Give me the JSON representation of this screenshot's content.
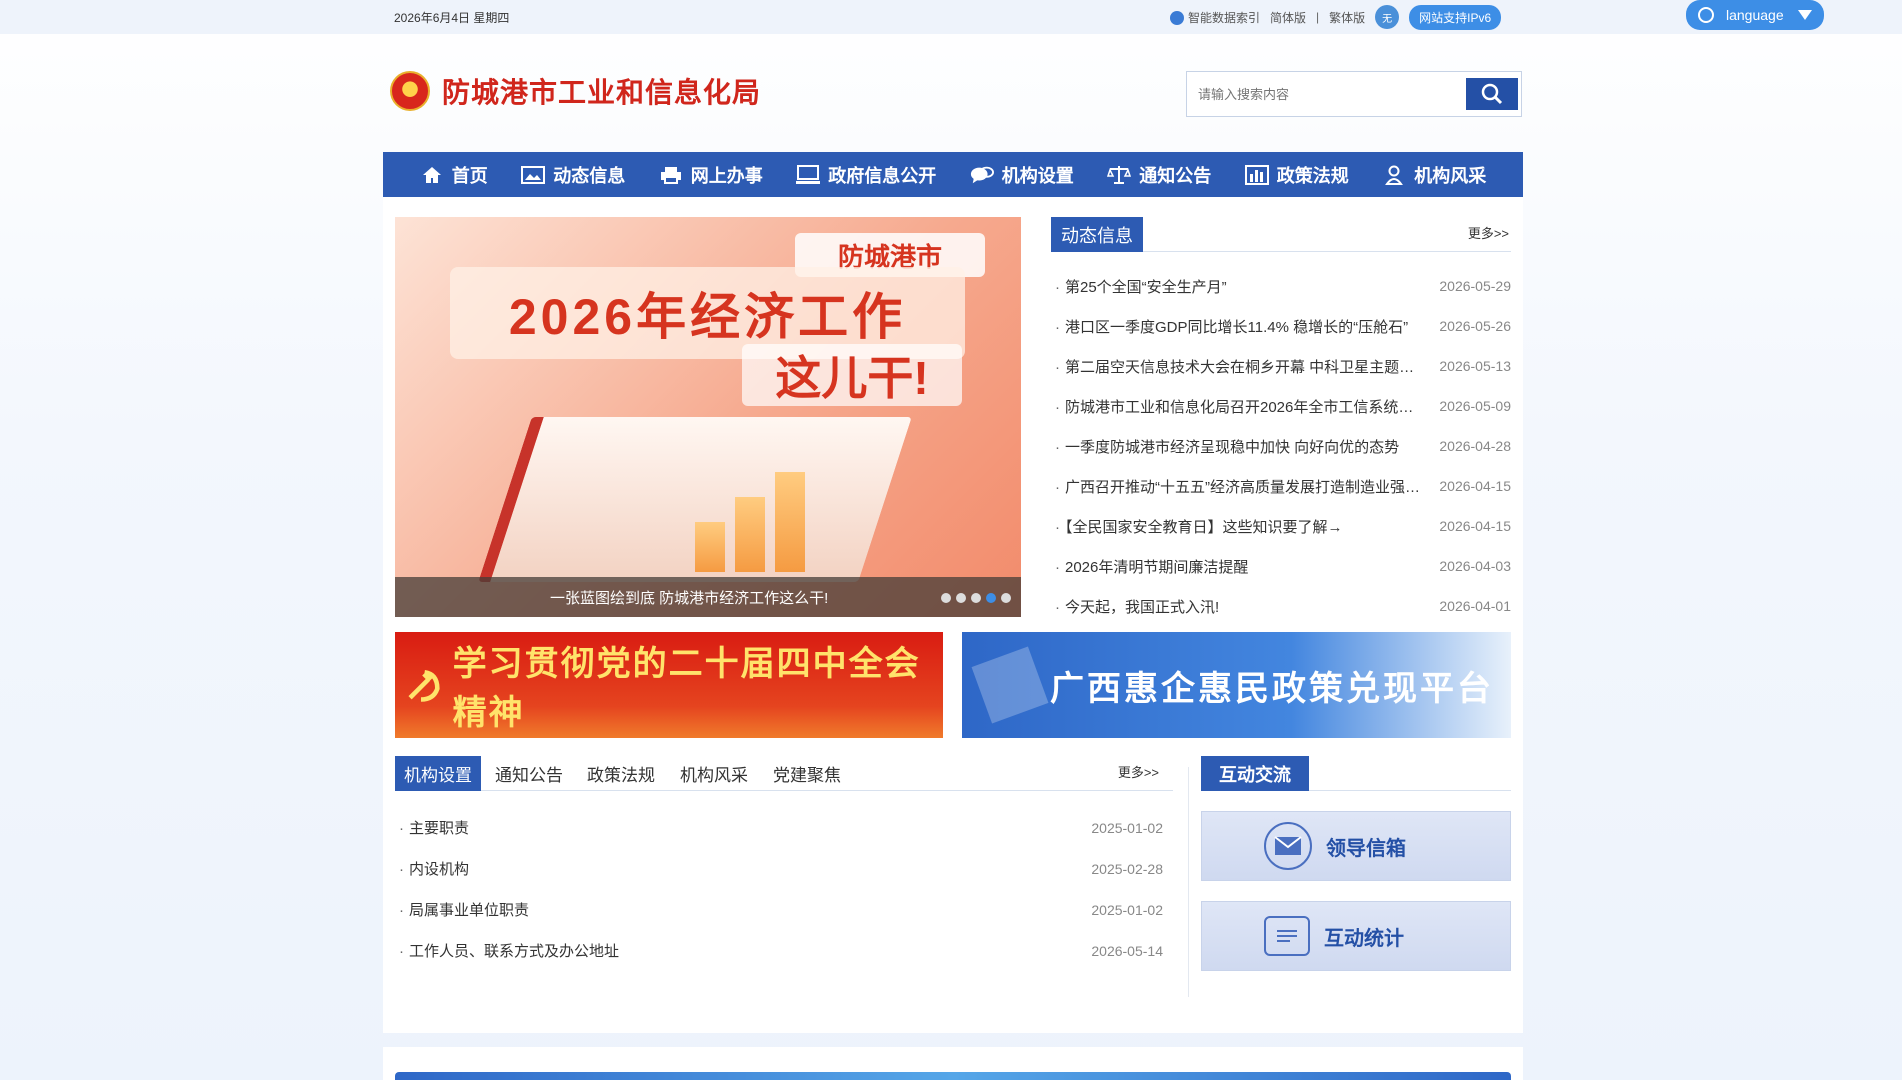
{
  "topbar": {
    "date": "2026年6月4日 星期四",
    "smart_index": "智能数据索引",
    "simplified": "简体版",
    "separator": "|",
    "traditional": "繁体版",
    "access_icon": "无",
    "ipv6": "网站支持IPv6",
    "language": "language"
  },
  "header": {
    "title": "防城港市工业和信息化局",
    "search_placeholder": "请输入搜索内容"
  },
  "nav": [
    {
      "label": "首页",
      "icon": "home-icon"
    },
    {
      "label": "动态信息",
      "icon": "image-icon"
    },
    {
      "label": "网上办事",
      "icon": "printer-icon"
    },
    {
      "label": "政府信息公开",
      "icon": "monitor-icon"
    },
    {
      "label": "机构设置",
      "icon": "chat-icon"
    },
    {
      "label": "通知公告",
      "icon": "scale-icon"
    },
    {
      "label": "政策法规",
      "icon": "bar-chart-icon"
    },
    {
      "label": "机构风采",
      "icon": "user-icon"
    }
  ],
  "slider": {
    "tag": "防城港市",
    "headline": "2026年经济工作",
    "subline": "这儿干!",
    "caption": "一张蓝图绘到底 防城港市经济工作这么干!",
    "active_dot": 3
  },
  "news": {
    "tab": "动态信息",
    "more": "更多>>",
    "items": [
      {
        "title": "第25个全国“安全生产月”",
        "date": "2026-05-29"
      },
      {
        "title": "港口区一季度GDP同比增长11.4% 稳增长的“压舱石”",
        "date": "2026-05-26"
      },
      {
        "title": "第二届空天信息技术大会在桐乡开幕 中科卫星主题展亮相",
        "date": "2026-05-13"
      },
      {
        "title": "防城港市工业和信息化局召开2026年全市工信系统工作会议",
        "date": "2026-05-09"
      },
      {
        "title": "一季度防城港市经济呈现稳中加快 向好向优的态势",
        "date": "2026-04-28"
      },
      {
        "title": "广西召开推动“十五五”经济高质量发展打造制造业强区会议",
        "date": "2026-04-15"
      },
      {
        "title": "【全民国家安全教育日】这些知识要了解→",
        "date": "2026-04-15"
      },
      {
        "title": "2026年清明节期间廉洁提醒",
        "date": "2026-04-03"
      },
      {
        "title": "今天起，我国正式入汛!",
        "date": "2026-04-01"
      }
    ]
  },
  "banners": {
    "left": "学习贯彻党的二十届四中全会精神",
    "right": "广西惠企惠民政策兑现平台"
  },
  "tabs": {
    "items": [
      "机构设置",
      "通知公告",
      "政策法规",
      "机构风采",
      "党建聚焦"
    ],
    "more": "更多>>",
    "rows": [
      {
        "title": "主要职责",
        "date": "2025-01-02"
      },
      {
        "title": "内设机构",
        "date": "2025-02-28"
      },
      {
        "title": "局属事业单位职责",
        "date": "2025-01-02"
      },
      {
        "title": "工作人员、联系方式及办公地址",
        "date": "2026-05-14"
      }
    ]
  },
  "interaction": {
    "tab": "互动交流",
    "mailbox": "领导信箱",
    "stats": "互动统计"
  },
  "colors": {
    "primary": "#2d5bb3",
    "title_red": "#d0261c",
    "accent": "#3d8ee6"
  }
}
